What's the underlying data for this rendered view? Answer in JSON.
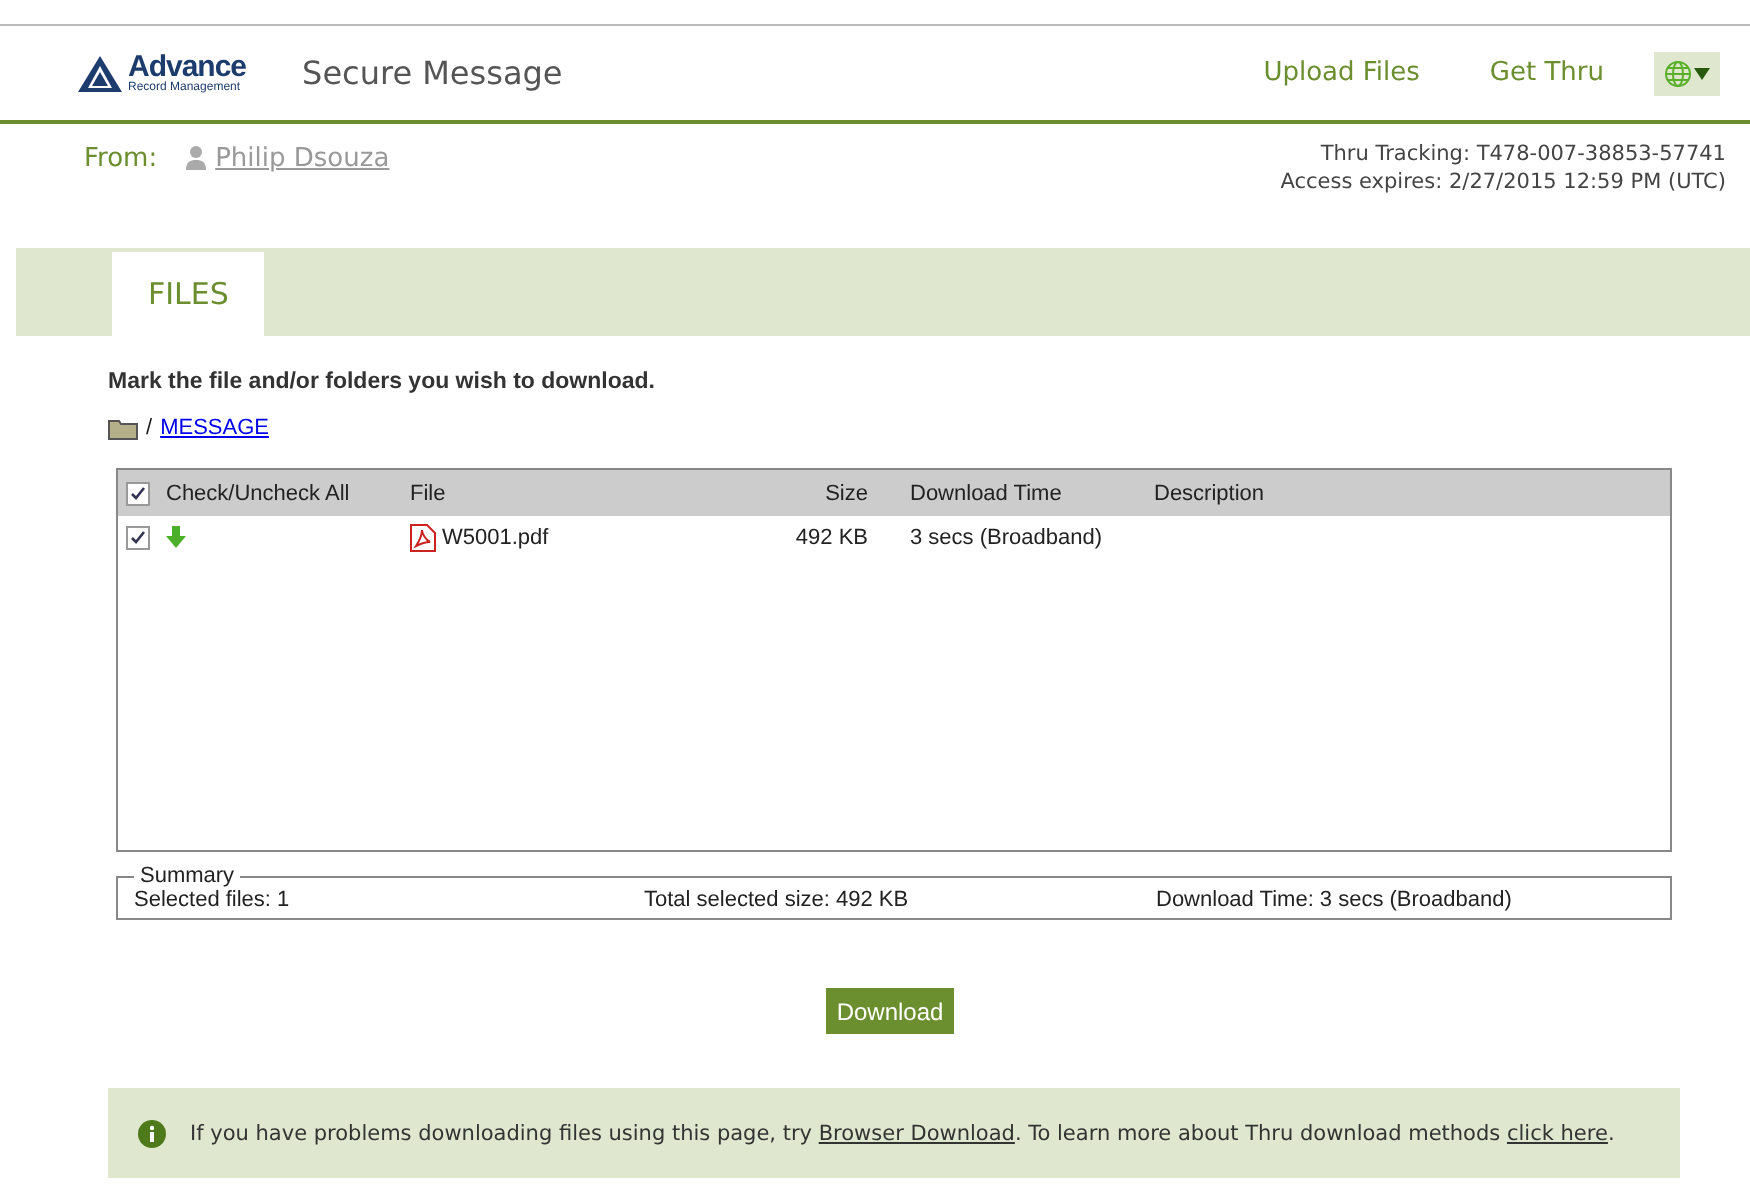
{
  "header": {
    "logo": {
      "name": "Advance",
      "tagline": "Record Management"
    },
    "title": "Secure Message",
    "nav": [
      {
        "label": "Upload Files"
      },
      {
        "label": "Get Thru"
      }
    ]
  },
  "sender": {
    "label": "From:",
    "name": "Philip Dsouza"
  },
  "tracking": [
    "Thru Tracking: T478-007-38853-57741",
    "Access expires: 2/27/2015 12:59 PM (UTC)"
  ],
  "tabs": [
    {
      "label": "FILES",
      "selected": true
    }
  ],
  "instruction": "Mark the file and/or folders you wish to download.",
  "breadcrumb": {
    "separator": "/",
    "folder": "MESSAGE"
  },
  "table": {
    "check_all": {
      "label": "Check/Uncheck All",
      "checked": true
    },
    "columns": [
      "File",
      "Size",
      "Download Time",
      "Description"
    ],
    "rows": [
      {
        "checked": true,
        "file": "W5001.pdf",
        "size": "492 KB",
        "time": "3 secs (Broadband)"
      }
    ]
  },
  "summary": {
    "legend": "Summary",
    "selected": "Selected files: 1",
    "total": "Total selected size: 492 KB",
    "time": "Download Time: 3 secs (Broadband)"
  },
  "download_button": "Download",
  "info": {
    "before": "If you have problems downloading files using this page, try ",
    "link1": "Browser Download",
    "middle": ". To learn more about Thru download methods ",
    "link2": "click here",
    "after": "."
  }
}
